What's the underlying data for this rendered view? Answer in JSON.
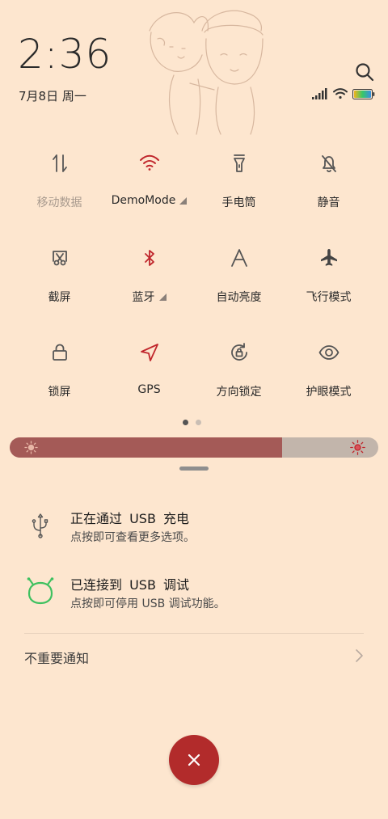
{
  "header": {
    "time": "2:36",
    "date": "7月8日 周一"
  },
  "quick_tiles": [
    {
      "label": "移动数据",
      "icon": "mobile-data-icon",
      "active": false,
      "has_arrow": false
    },
    {
      "label": "DemoMode",
      "icon": "wifi-icon",
      "active": true,
      "has_arrow": true
    },
    {
      "label": "手电筒",
      "icon": "flashlight-icon",
      "active": false,
      "has_arrow": false
    },
    {
      "label": "静音",
      "icon": "mute-bell-icon",
      "active": false,
      "has_arrow": false
    },
    {
      "label": "截屏",
      "icon": "screenshot-icon",
      "active": false,
      "has_arrow": false
    },
    {
      "label": "蓝牙",
      "icon": "bluetooth-icon",
      "active": true,
      "has_arrow": true
    },
    {
      "label": "自动亮度",
      "icon": "auto-brightness-icon",
      "active": false,
      "has_arrow": false
    },
    {
      "label": "飞行模式",
      "icon": "airplane-icon",
      "active": false,
      "has_arrow": false
    },
    {
      "label": "锁屏",
      "icon": "lock-icon",
      "active": false,
      "has_arrow": false
    },
    {
      "label": "GPS",
      "icon": "gps-icon",
      "active": true,
      "has_arrow": false
    },
    {
      "label": "方向锁定",
      "icon": "rotation-lock-icon",
      "active": false,
      "has_arrow": false
    },
    {
      "label": "护眼模式",
      "icon": "eye-icon",
      "active": false,
      "has_arrow": false
    }
  ],
  "pager": {
    "pages": 2,
    "current": 1
  },
  "brightness": {
    "level": 0.74
  },
  "notifications": [
    {
      "title": "正在通过 USB 充电",
      "subtitle": "点按即可查看更多选项。",
      "icon": "usb-icon"
    },
    {
      "title": "已连接到 USB 调试",
      "subtitle": "点按即可停用 USB 调试功能。",
      "icon": "android-icon"
    }
  ],
  "unimportant": {
    "label": "不重要通知"
  },
  "colors": {
    "background": "#fde6cf",
    "accent_red": "#c0262c",
    "brightness_fill": "#a45a57",
    "brightness_track": "#c2b5ab",
    "fab": "#b22b2b",
    "android_green": "#3fc160"
  }
}
